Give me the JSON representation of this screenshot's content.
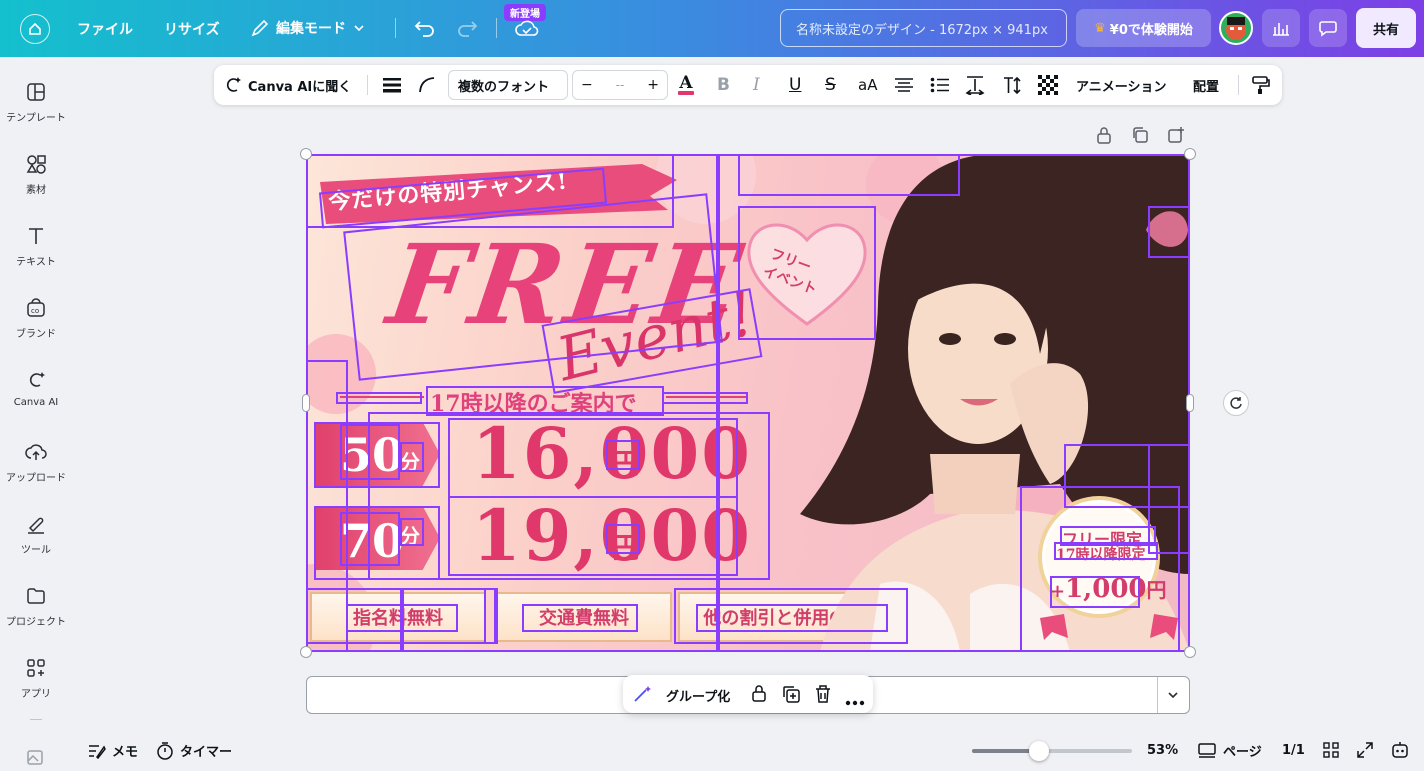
{
  "topbar": {
    "file": "ファイル",
    "resize": "リサイズ",
    "edit_mode": "編集モード",
    "new_badge": "新登場",
    "doc_title": "名称未設定のデザイン - 1672px × 941px",
    "trial": "¥0で体験開始",
    "share": "共有"
  },
  "sidebar": {
    "items": [
      {
        "label": "テンプレート",
        "icon": "template-icon"
      },
      {
        "label": "素材",
        "icon": "elements-icon"
      },
      {
        "label": "テキスト",
        "icon": "text-icon"
      },
      {
        "label": "ブランド",
        "icon": "brand-icon"
      },
      {
        "label": "Canva AI",
        "icon": "canva-ai-icon"
      },
      {
        "label": "アップロード",
        "icon": "upload-icon"
      },
      {
        "label": "ツール",
        "icon": "tools-icon"
      },
      {
        "label": "プロジェクト",
        "icon": "folder-icon"
      },
      {
        "label": "アプリ",
        "icon": "apps-icon"
      }
    ]
  },
  "toolbar": {
    "canva_ai": "Canva AIに聞く",
    "font": "複数のフォント",
    "size_value": "--",
    "minus": "−",
    "plus": "+",
    "case": "aA",
    "animation": "アニメーション",
    "position": "配置"
  },
  "design": {
    "ribbon": "今だけの特別チャンス!",
    "free": "FREE",
    "event": "Event!",
    "heart_text_1": "フリー",
    "heart_text_2": "イベント",
    "subtitle": "17時以降のご案内で",
    "row1": {
      "minutes": "50",
      "unit": "分",
      "price": "16,000",
      "yen": "円"
    },
    "row2": {
      "minutes": "70",
      "unit": "分",
      "price": "19,000",
      "yen": "円"
    },
    "plaques": [
      "指名料無料",
      "交通費無料",
      "他の割引と併用OK！"
    ],
    "circle": {
      "line1": "フリー限定",
      "line2": "17時以降限定",
      "plus": "+",
      "amount": "1,000",
      "yen": "円"
    }
  },
  "context_menu": {
    "group": "グループ化"
  },
  "bottombar": {
    "memo": "メモ",
    "timer": "タイマー",
    "zoom": "53%",
    "zoom_fraction": 0.42,
    "pages": "ページ",
    "page_count": "1/1"
  }
}
